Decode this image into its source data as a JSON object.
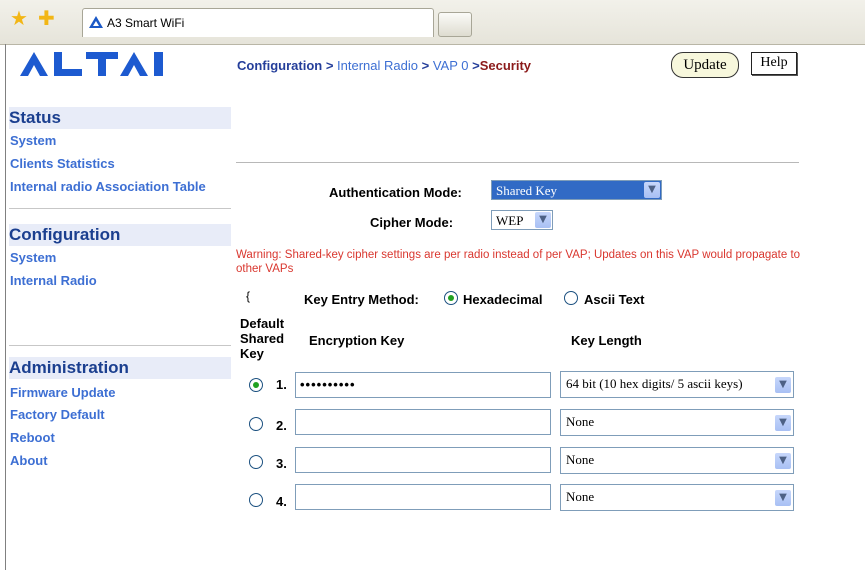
{
  "browser": {
    "tab_title": "A3 Smart WiFi"
  },
  "brand": {
    "logo_text": "ALTAI"
  },
  "sidebar": {
    "status": {
      "heading": "Status",
      "items": [
        "System",
        "Clients Statistics",
        "Internal radio Association Table"
      ]
    },
    "configuration": {
      "heading": "Configuration",
      "items": [
        "System",
        "Internal Radio"
      ]
    },
    "administration": {
      "heading": "Administration",
      "items": [
        "Firmware Update",
        "Factory Default",
        "Reboot",
        "About"
      ]
    }
  },
  "breadcrumb": {
    "part1": "Configuration",
    "sep1": " > ",
    "part2": "Internal Radio",
    "sep2": " > ",
    "part3": "VAP 0",
    "sep3": " >",
    "part4": "Security"
  },
  "toolbar": {
    "update_label": "Update",
    "help_label": "Help"
  },
  "form": {
    "auth_mode_label": "Authentication Mode:",
    "auth_mode_value": "Shared Key",
    "cipher_mode_label": "Cipher Mode:",
    "cipher_mode_value": "WEP",
    "warning": "Warning: Shared-key cipher settings are per radio instead of per VAP; Updates on this VAP would propagate to other VAPs",
    "stray_char": "{",
    "key_entry_label": "Key Entry Method:",
    "key_entry_options": [
      "Hexadecimal",
      "Ascii Text"
    ],
    "columns": {
      "default": "Default Shared Key",
      "encryption": "Encryption Key",
      "length": "Key Length"
    },
    "keys": [
      {
        "num": "1.",
        "value": "••••••••••",
        "length": "64 bit (10 hex digits/ 5 ascii keys)",
        "selected": true
      },
      {
        "num": "2.",
        "value": "",
        "length": "None",
        "selected": false
      },
      {
        "num": "3.",
        "value": "",
        "length": "None",
        "selected": false
      },
      {
        "num": "4.",
        "value": "",
        "length": "None",
        "selected": false
      }
    ]
  },
  "colors": {
    "heading_blue": "#1b3f8f",
    "link_blue": "#3d6fd3",
    "warning_red": "#d9372f",
    "security_red": "#8b1a1a",
    "selected_blue": "#316ac5"
  }
}
